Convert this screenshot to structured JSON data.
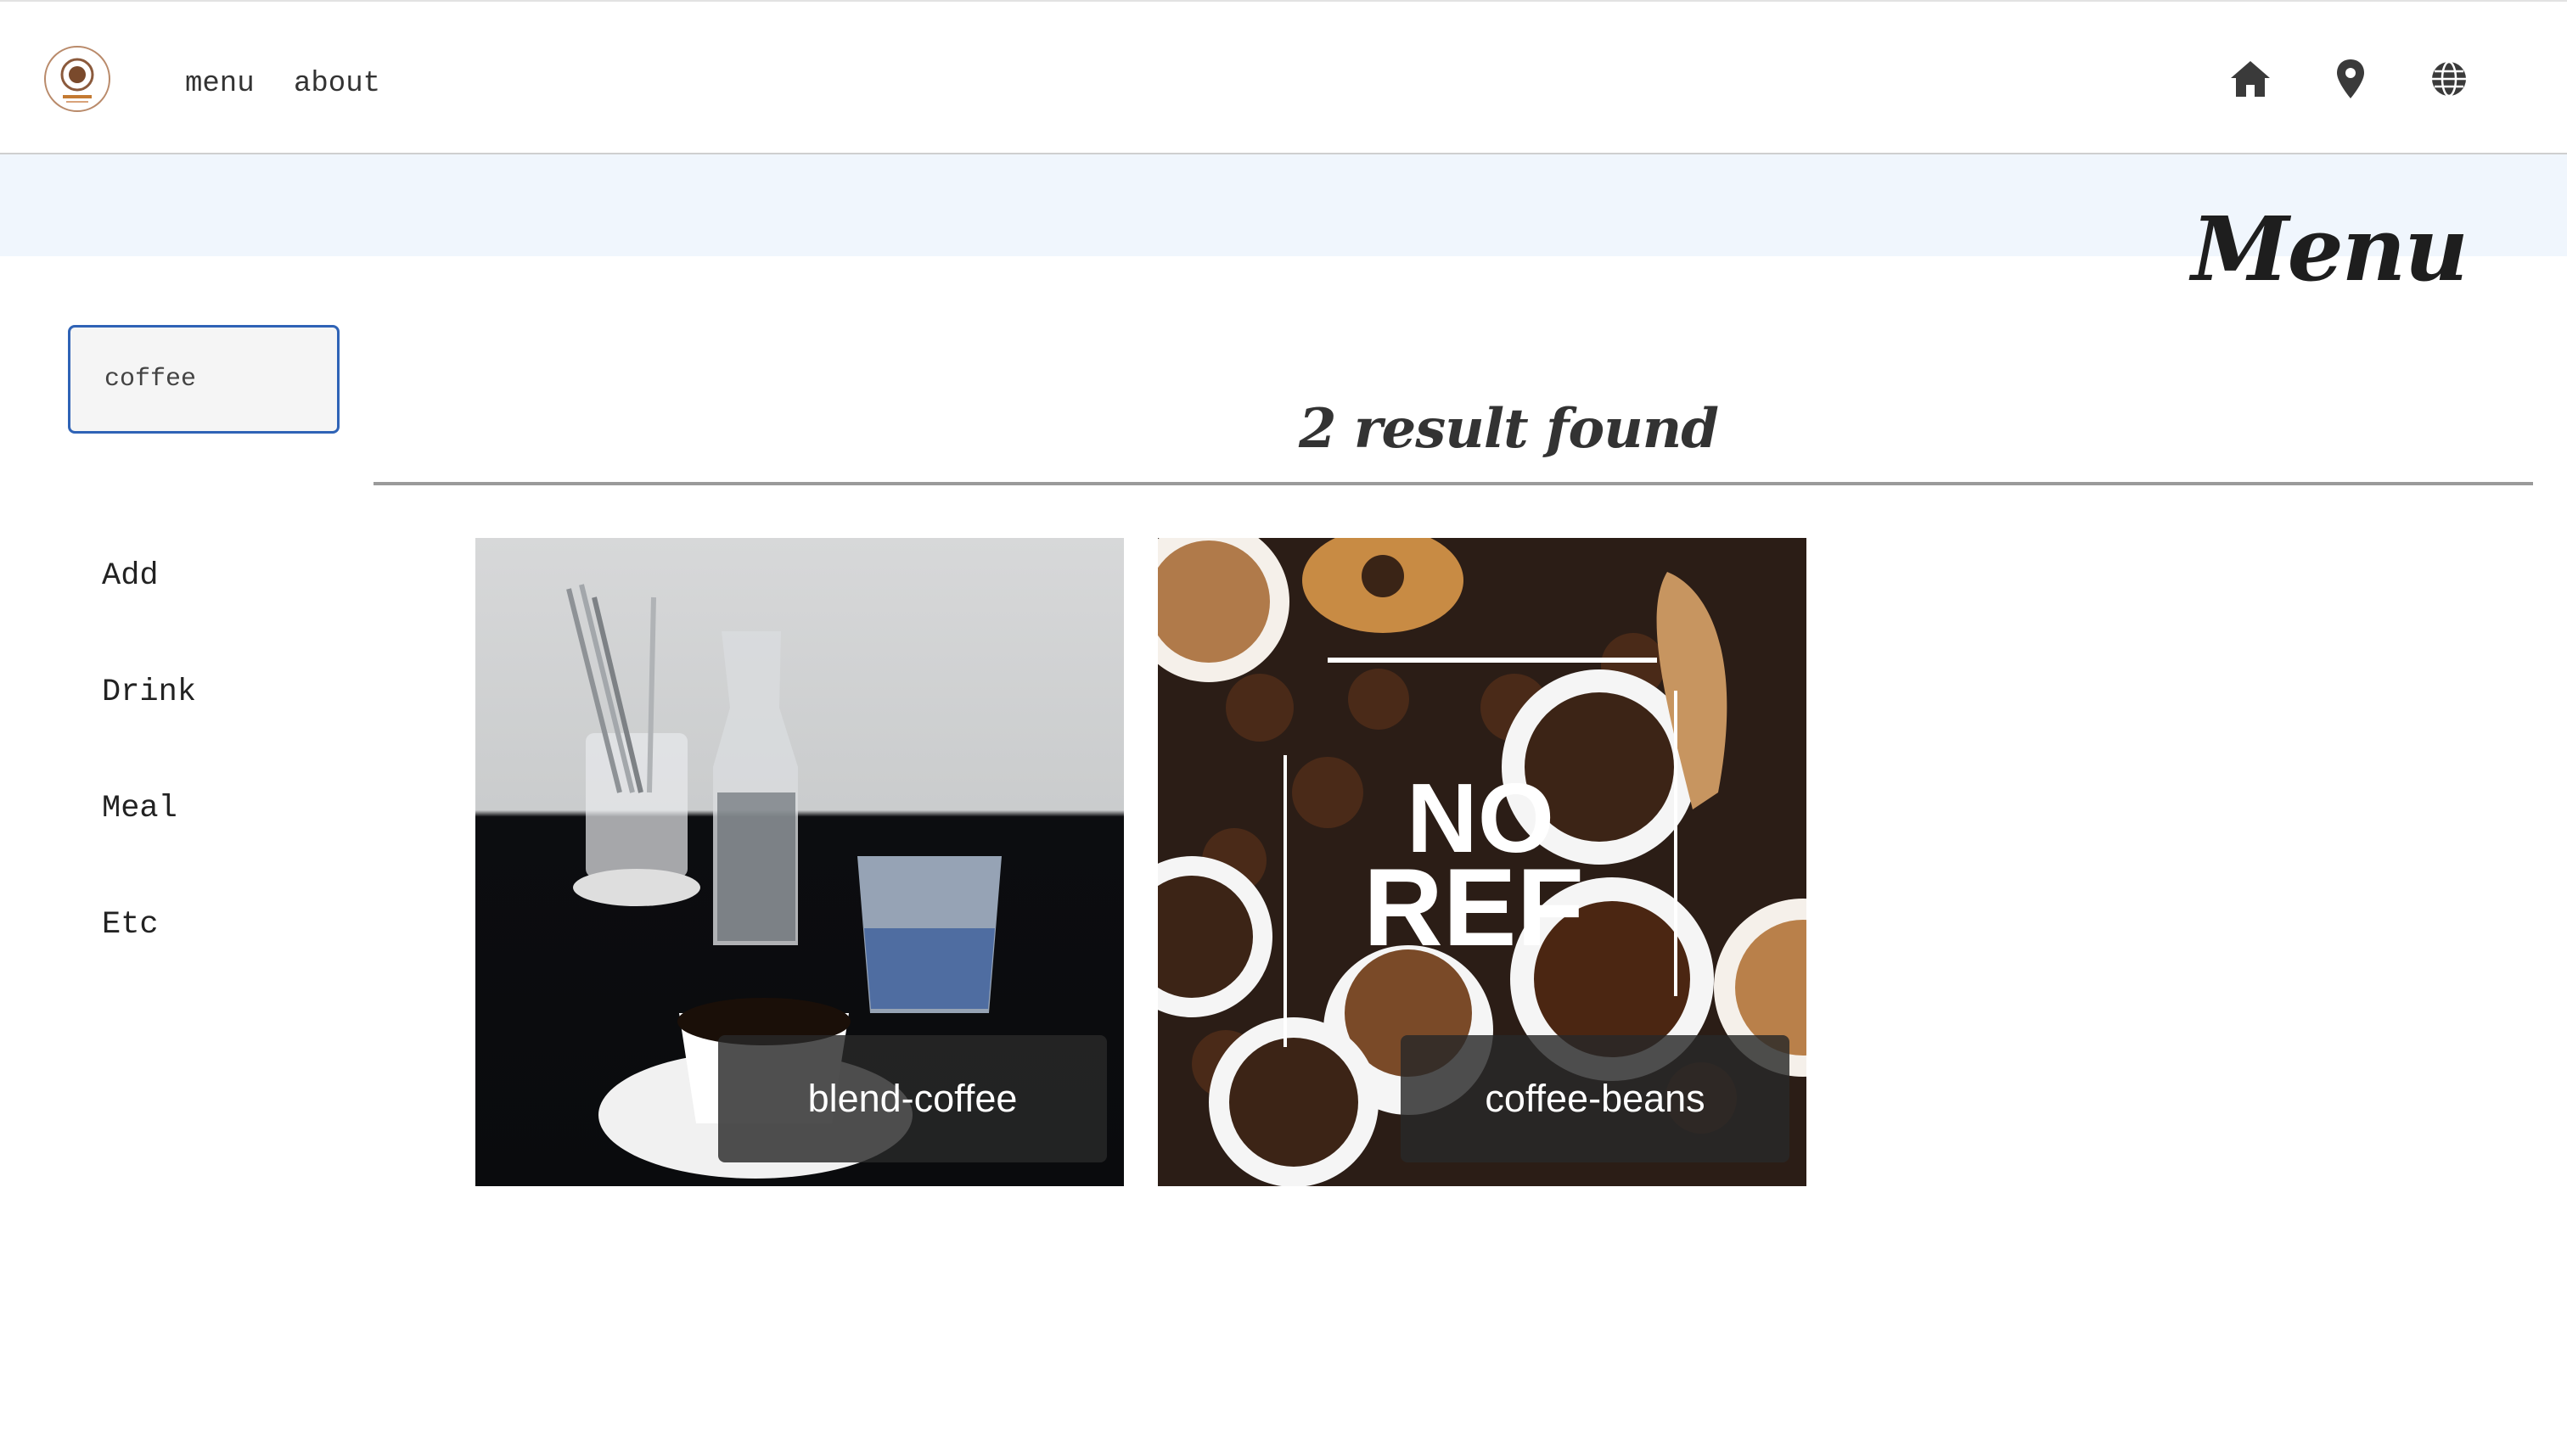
{
  "nav": {
    "links": [
      {
        "label": "menu"
      },
      {
        "label": "about"
      }
    ],
    "icons": [
      "home-icon",
      "location-pin-icon",
      "globe-icon"
    ]
  },
  "banner": {
    "title": "Menu",
    "background": "#f0f6fd"
  },
  "search": {
    "value": "coffee",
    "placeholder": "",
    "border_color": "#2f63b6"
  },
  "sidebar": {
    "items": [
      {
        "label": "Add"
      },
      {
        "label": "Drink"
      },
      {
        "label": "Meal"
      },
      {
        "label": "Etc"
      }
    ]
  },
  "results": {
    "heading": "2 result found",
    "items": [
      {
        "label": "blend-coffee"
      },
      {
        "label": "coffee-beans",
        "overlay_text": [
          "NO",
          "REF"
        ]
      }
    ]
  }
}
